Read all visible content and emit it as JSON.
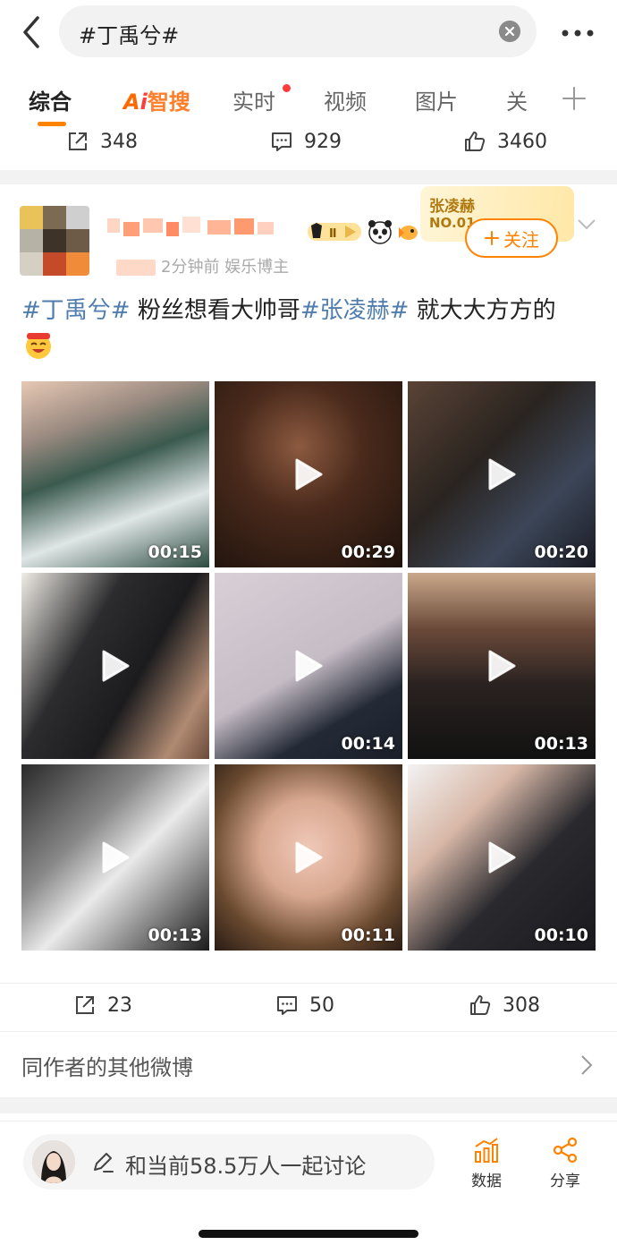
{
  "search": {
    "query": "#丁禹兮#"
  },
  "tabs": {
    "items": [
      "综合",
      "实时",
      "视频",
      "图片",
      "关"
    ],
    "ai_a": "A",
    "ai_i": "i",
    "ai_label": "智搜"
  },
  "top_actions": {
    "repost": "348",
    "comment": "929",
    "like": "3460"
  },
  "post": {
    "time_meta": "2分钟前  娱乐博主",
    "rank_card": {
      "name": "张凌赫",
      "rank": "NO.01"
    },
    "follow_label": "关注",
    "text_tag1": "#丁禹兮#",
    "text_mid": " 粉丝想看大帅哥",
    "text_tag2": "#张凌赫#",
    "text_end": " 就大大方方的",
    "videos": [
      {
        "duration": "00:15",
        "play": false,
        "bg": "linear-gradient(160deg,#e7c8b4 0%,#9a8a80 25%,#3b5a4f 45%,#dfe6e6 70%,#2c4a40 100%)"
      },
      {
        "duration": "00:29",
        "play": true,
        "bg": "radial-gradient(circle at 45% 35%,#8c5a40 0%,#4a2a1c 40%,#1d120c 100%)"
      },
      {
        "duration": "00:20",
        "play": true,
        "bg": "linear-gradient(135deg,#5a4336 0%,#2a2420 40%,#3c4658 70%,#1a1c24 100%)"
      },
      {
        "duration": "",
        "play": true,
        "bg": "linear-gradient(120deg,#f0ece6 0%,#2c2c2e 35%,#1c1c1e 60%,#b08a72 85%,#6a4a3a 100%)"
      },
      {
        "duration": "00:14",
        "play": true,
        "bg": "linear-gradient(150deg,#d9cfd6 0%,#c6bcc6 50%,#232a36 75%,#1a1e28 100%)"
      },
      {
        "duration": "00:13",
        "play": true,
        "bg": "linear-gradient(180deg,#c9a88a 0%,#6b4a3a 30%,#2a2220 60%,#111 100%)"
      },
      {
        "duration": "00:13",
        "play": true,
        "bg": "linear-gradient(135deg,#2a2a2a 0%,#888 35%,#eaeaea 55%,#1a1a1a 100%)"
      },
      {
        "duration": "00:11",
        "play": true,
        "bg": "radial-gradient(circle at 50% 45%,#f0c8b8 0%,#d8a890 35%,#6a4a30 70%,#2a1c14 100%)"
      },
      {
        "duration": "00:10",
        "play": true,
        "bg": "linear-gradient(135deg,#f2f2f2 0%,#d8b8a8 30%,#2a2a2e 60%,#1a1a1e 100%)"
      }
    ]
  },
  "bottom_actions": {
    "repost": "23",
    "comment": "50",
    "like": "308"
  },
  "more_link": "同作者的其他微博",
  "footer": {
    "discuss": "和当前58.5万人一起讨论",
    "data_label": "数据",
    "share_label": "分享"
  },
  "colors": {
    "accent": "#ff8200",
    "link": "#507daf",
    "divider": "#f2f2f2"
  }
}
